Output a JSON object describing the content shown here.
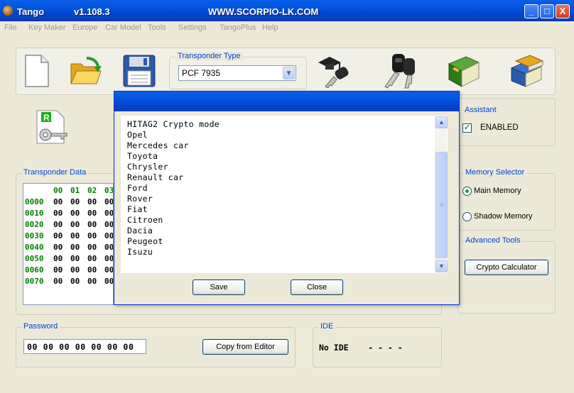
{
  "window": {
    "title": "Tango",
    "version": "v1.108.3",
    "website": "WWW.SCORPIO-LK.COM",
    "controls": [
      "_",
      "□",
      "X"
    ]
  },
  "menu": [
    "File",
    "Key Maker",
    "Europe",
    "Car Model",
    "Tools",
    "Settings",
    "TangoPlus",
    "Help"
  ],
  "toolbar": {
    "icons": [
      "new-file-icon",
      "open-folder-icon",
      "save-disk-icon",
      "graduate-key-icon",
      "keys-icon",
      "green-book-icon",
      "books-icon",
      "key-file-icon"
    ]
  },
  "transponder_type": {
    "label": "Transponder Type",
    "value": "PCF 7935"
  },
  "assistant": {
    "label": "Assistant",
    "checkbox_label": "ENABLED",
    "checked": true
  },
  "memory_selector": {
    "label": "Memory Selector",
    "options": [
      "Main Memory",
      "Shadow Memory"
    ],
    "selected": "Main Memory"
  },
  "advanced_tools": {
    "label": "Advanced Tools",
    "button": "Crypto Calculator"
  },
  "transponder_data": {
    "label": "Transponder Data",
    "columns": [
      "00",
      "01",
      "02",
      "03"
    ],
    "rows": [
      {
        "addr": "0000",
        "cells": [
          "00",
          "00",
          "00",
          "00"
        ]
      },
      {
        "addr": "0010",
        "cells": [
          "00",
          "00",
          "00",
          "00"
        ]
      },
      {
        "addr": "0020",
        "cells": [
          "00",
          "00",
          "00",
          "00"
        ]
      },
      {
        "addr": "0030",
        "cells": [
          "00",
          "00",
          "00",
          "00"
        ]
      },
      {
        "addr": "0040",
        "cells": [
          "00",
          "00",
          "00",
          "00"
        ]
      },
      {
        "addr": "0050",
        "cells": [
          "00",
          "00",
          "00",
          "00"
        ]
      },
      {
        "addr": "0060",
        "cells": [
          "00",
          "00",
          "00",
          "00"
        ]
      },
      {
        "addr": "0070",
        "cells": [
          "00",
          "00",
          "00",
          "00"
        ]
      }
    ]
  },
  "password": {
    "label": "Password",
    "value": "00 00 00 00 00 00 00",
    "button": "Copy from Editor"
  },
  "ide": {
    "label": "IDE",
    "value": "No IDE    - - - -"
  },
  "dialog": {
    "items": [
      "HITAG2 Crypto mode",
      "Opel",
      "Mercedes car",
      "Toyota",
      "Chrysler",
      "Renault car",
      "Ford",
      "Rover",
      "Fiat",
      "Citroen",
      "Dacia",
      "Peugeot",
      "Isuzu"
    ],
    "save_label": "Save",
    "close_label": "Close"
  }
}
